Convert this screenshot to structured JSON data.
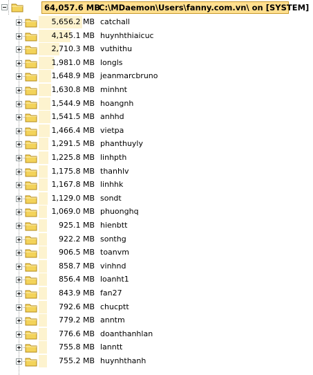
{
  "root": {
    "size": "64,057.6 MB",
    "path": "C:\\MDaemon\\Users\\fanny.com.vn\\ on [SYSTEM]"
  },
  "folders": [
    {
      "size": "5,656.2 MB",
      "name": "catchall",
      "fraction": 1.0
    },
    {
      "size": "4,145.1 MB",
      "name": "huynhthiaicuc",
      "fraction": 0.733
    },
    {
      "size": "2,710.3 MB",
      "name": "vuthithu",
      "fraction": 0.479
    },
    {
      "size": "1,981.0 MB",
      "name": "longls",
      "fraction": 0.35
    },
    {
      "size": "1,648.9 MB",
      "name": "jeanmarcbruno",
      "fraction": 0.292
    },
    {
      "size": "1,630.8 MB",
      "name": "minhnt",
      "fraction": 0.288
    },
    {
      "size": "1,544.9 MB",
      "name": "hoangnh",
      "fraction": 0.273
    },
    {
      "size": "1,541.5 MB",
      "name": "anhhd",
      "fraction": 0.273
    },
    {
      "size": "1,466.4 MB",
      "name": "vietpa",
      "fraction": 0.259
    },
    {
      "size": "1,291.5 MB",
      "name": "phanthuyly",
      "fraction": 0.228
    },
    {
      "size": "1,225.8 MB",
      "name": "linhpth",
      "fraction": 0.217
    },
    {
      "size": "1,175.8 MB",
      "name": "thanhlv",
      "fraction": 0.208
    },
    {
      "size": "1,167.8 MB",
      "name": "linhhk",
      "fraction": 0.206
    },
    {
      "size": "1,129.0 MB",
      "name": "sondt",
      "fraction": 0.2
    },
    {
      "size": "1,069.0 MB",
      "name": "phuonghq",
      "fraction": 0.189
    },
    {
      "size": "925.1 MB",
      "name": "hienbtt",
      "fraction": 0.164
    },
    {
      "size": "922.2 MB",
      "name": "sonthg",
      "fraction": 0.163
    },
    {
      "size": "906.5 MB",
      "name": "toanvm",
      "fraction": 0.16
    },
    {
      "size": "858.7 MB",
      "name": "vinhnd",
      "fraction": 0.152
    },
    {
      "size": "856.4 MB",
      "name": "loanht1",
      "fraction": 0.151
    },
    {
      "size": "843.9 MB",
      "name": "fan27",
      "fraction": 0.149
    },
    {
      "size": "792.6 MB",
      "name": "chucptt",
      "fraction": 0.14
    },
    {
      "size": "779.2 MB",
      "name": "anntm",
      "fraction": 0.138
    },
    {
      "size": "776.6 MB",
      "name": "doanthanhlan",
      "fraction": 0.137
    },
    {
      "size": "755.8 MB",
      "name": "lanntt",
      "fraction": 0.134
    },
    {
      "size": "755.2 MB",
      "name": "huynhthanh",
      "fraction": 0.134
    }
  ],
  "icons": {
    "expander": "plus-box-icon",
    "folder": "folder-icon",
    "folder_color": "#f3d35a"
  }
}
